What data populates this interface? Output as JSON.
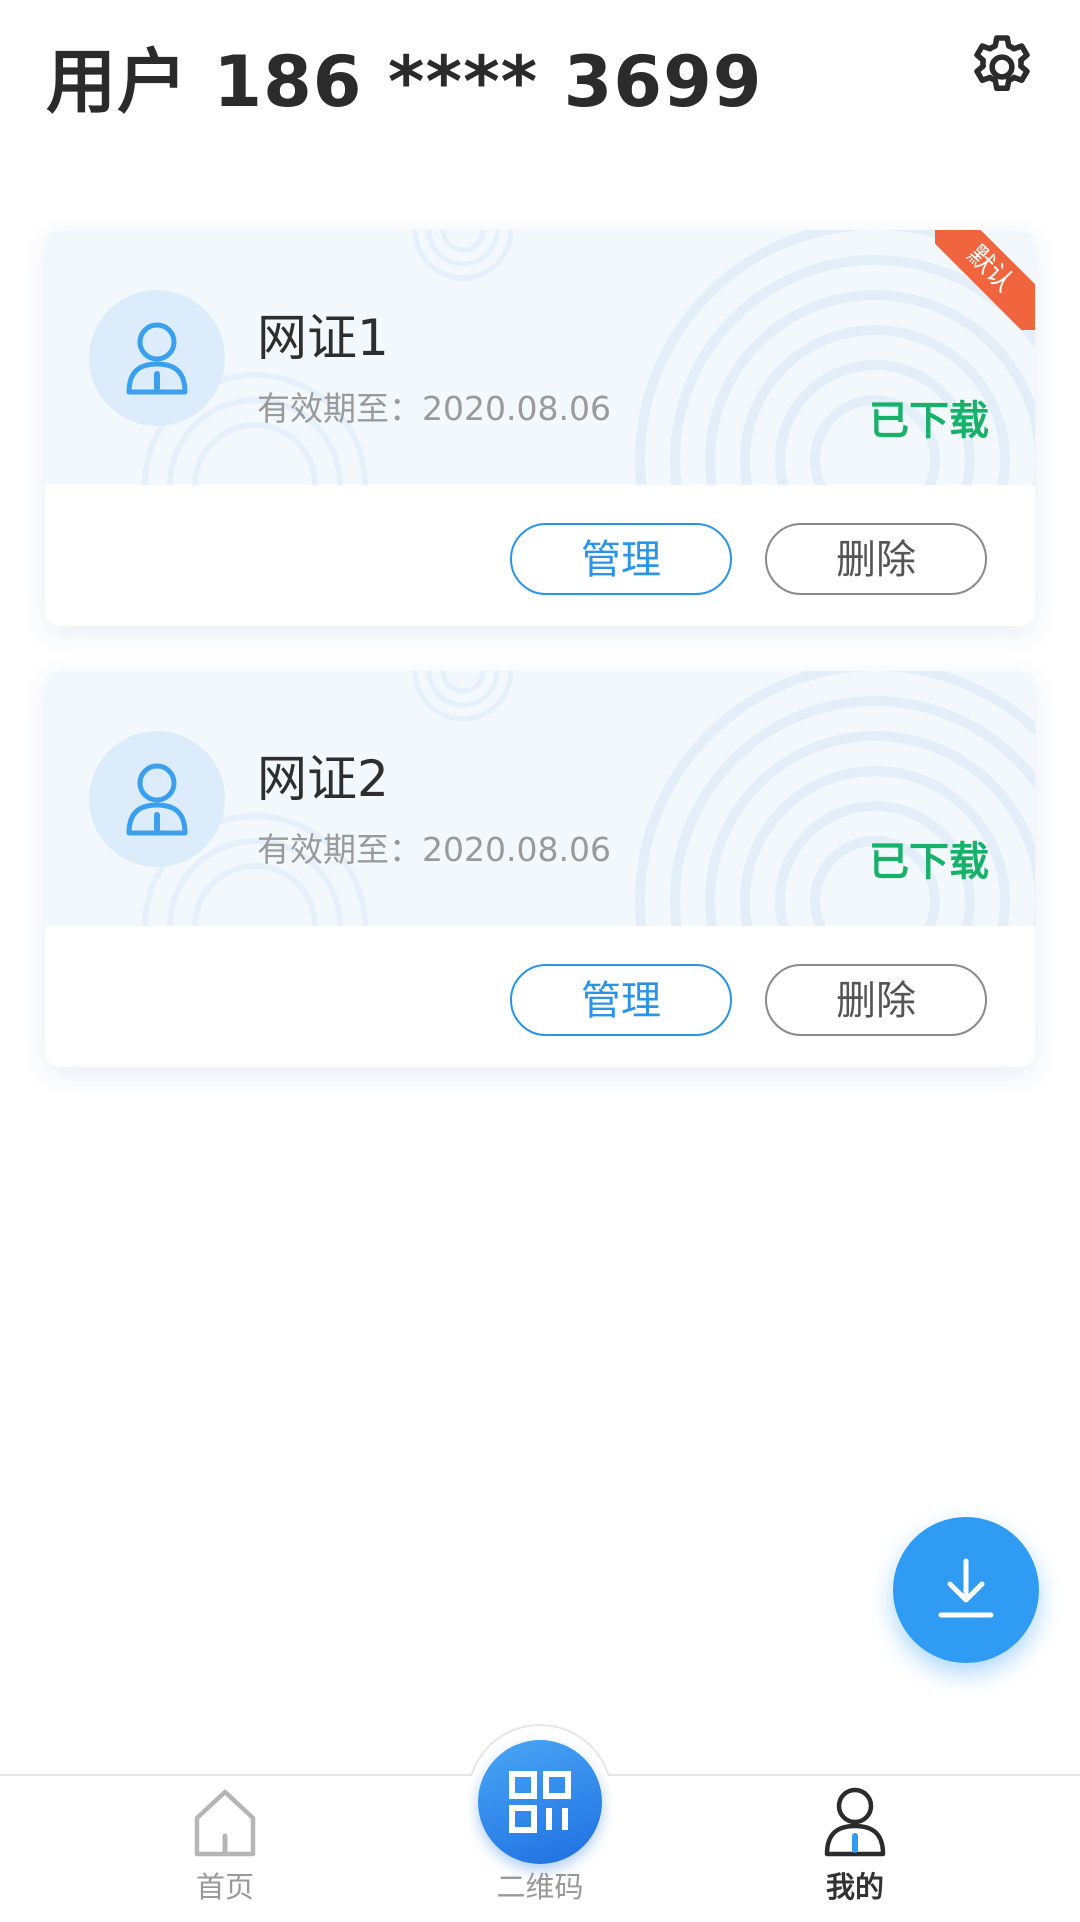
{
  "header": {
    "title": "用户  186 **** 3699",
    "settings_icon": "gear-icon"
  },
  "certificates": [
    {
      "name": "网证1",
      "expiry": "有效期至：2020.08.06",
      "status": "已下载",
      "badge": "默认",
      "manage_label": "管理",
      "delete_label": "删除"
    },
    {
      "name": "网证2",
      "expiry": "有效期至：2020.08.06",
      "status": "已下载",
      "manage_label": "管理",
      "delete_label": "删除"
    }
  ],
  "fab": {
    "icon": "download-icon"
  },
  "bottom_nav": {
    "items": [
      {
        "label": "首页",
        "icon": "home-icon",
        "active": false
      },
      {
        "label": "二维码",
        "icon": "qrcode-icon",
        "active": false
      },
      {
        "label": "我的",
        "icon": "user-icon",
        "active": true
      }
    ]
  },
  "colors": {
    "accent": "#2b94e6",
    "status_green": "#17b26a",
    "badge_orange": "#f0643e",
    "card_top_bg": "#f3f8fd"
  }
}
